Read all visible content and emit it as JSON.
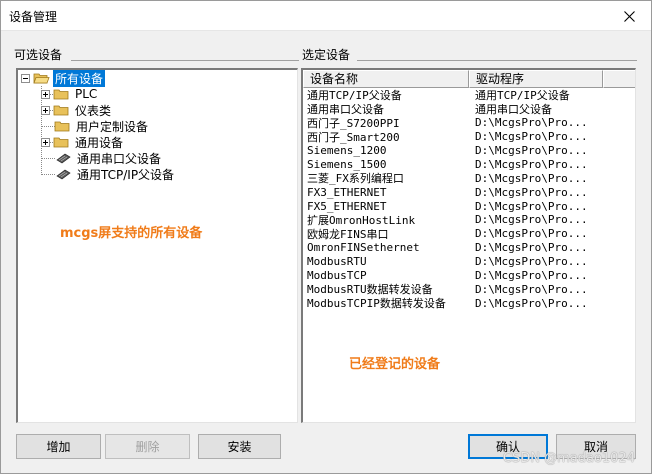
{
  "window": {
    "title": "设备管理"
  },
  "left_panel": {
    "label": "可选设备",
    "tree": {
      "root": "所有设备",
      "children": [
        {
          "label": "PLC",
          "type": "folder",
          "expandable": true
        },
        {
          "label": "仪表类",
          "type": "folder",
          "expandable": true
        },
        {
          "label": "用户定制设备",
          "type": "folder",
          "expandable": false
        },
        {
          "label": "通用设备",
          "type": "folder",
          "expandable": true
        },
        {
          "label": "通用串口父设备",
          "type": "device",
          "expandable": false
        },
        {
          "label": "通用TCP/IP父设备",
          "type": "device",
          "expandable": false
        }
      ]
    },
    "annotation": "mcgs屏支持的所有设备"
  },
  "right_panel": {
    "label": "选定设备",
    "columns": [
      "设备名称",
      "驱动程序",
      ""
    ],
    "rows": [
      {
        "name": "通用TCP/IP父设备",
        "driver": "通用TCP/IP父设备"
      },
      {
        "name": "通用串口父设备",
        "driver": "通用串口父设备"
      },
      {
        "name": "西门子_S7200PPI",
        "driver": "D:\\McgsPro\\Pro..."
      },
      {
        "name": "西门子_Smart200",
        "driver": "D:\\McgsPro\\Pro..."
      },
      {
        "name": "Siemens_1200",
        "driver": "D:\\McgsPro\\Pro..."
      },
      {
        "name": "Siemens_1500",
        "driver": "D:\\McgsPro\\Pro..."
      },
      {
        "name": "三菱_FX系列编程口",
        "driver": "D:\\McgsPro\\Pro..."
      },
      {
        "name": "FX3_ETHERNET",
        "driver": "D:\\McgsPro\\Pro..."
      },
      {
        "name": "FX5_ETHERNET",
        "driver": "D:\\McgsPro\\Pro..."
      },
      {
        "name": "扩展OmronHostLink",
        "driver": "D:\\McgsPro\\Pro..."
      },
      {
        "name": "欧姆龙FINS串口",
        "driver": "D:\\McgsPro\\Pro..."
      },
      {
        "name": "OmronFINSethernet",
        "driver": "D:\\McgsPro\\Pro..."
      },
      {
        "name": "ModbusRTU",
        "driver": "D:\\McgsPro\\Pro..."
      },
      {
        "name": "ModbusTCP",
        "driver": "D:\\McgsPro\\Pro..."
      },
      {
        "name": "ModbusRTU数据转发设备",
        "driver": "D:\\McgsPro\\Pro..."
      },
      {
        "name": "ModbusTCPIP数据转发设备",
        "driver": "D:\\McgsPro\\Pro..."
      }
    ],
    "annotation": "已经登记的设备"
  },
  "buttons": {
    "add": "增加",
    "delete": "删除",
    "install": "安装",
    "ok": "确认",
    "cancel": "取消"
  },
  "watermark": "CSDN @madao1024",
  "colors": {
    "selection": "#0078d7",
    "annotation": "#f07c1a",
    "folder": "#e8c15a"
  }
}
